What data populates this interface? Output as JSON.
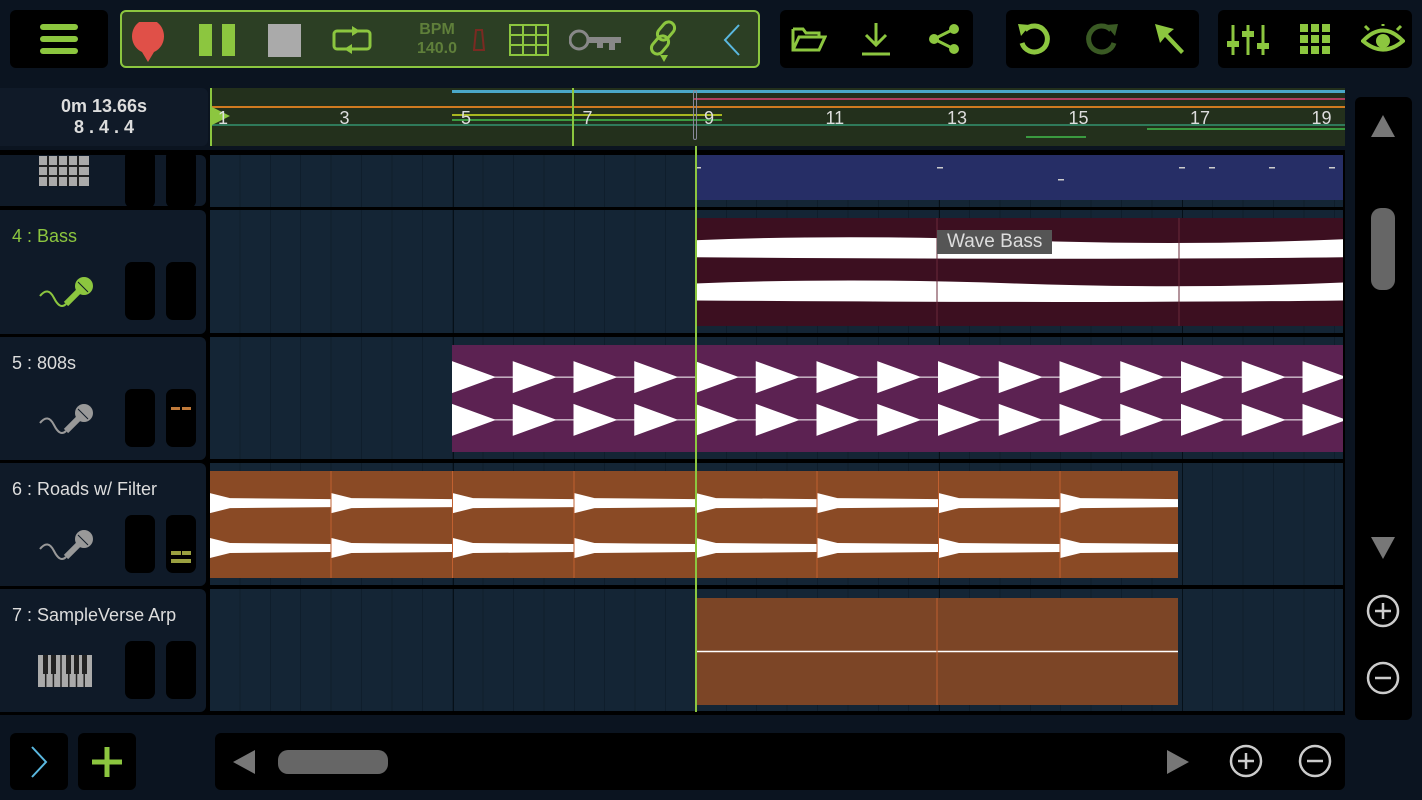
{
  "toolbar": {
    "bpm_label": "BPM",
    "bpm_value": "140.0"
  },
  "position": {
    "time": "0m 13.66s",
    "bars": "8 . 4 . 4"
  },
  "ruler": {
    "ticks": [
      "1",
      "3",
      "5",
      "7",
      "9",
      "11",
      "13",
      "15",
      "17",
      "19"
    ]
  },
  "tracks": [
    {
      "name": "",
      "icon": "drum-pad-icon"
    },
    {
      "name": "4 : Bass",
      "icon": "microphone-icon",
      "selected": true,
      "clip_label": "Wave Bass"
    },
    {
      "name": "5 : 808s",
      "icon": "microphone-icon"
    },
    {
      "name": "6 : Roads w/ Filter",
      "icon": "microphone-icon"
    },
    {
      "name": "7 : SampleVerse Arp",
      "icon": "piano-keyboard-icon"
    }
  ],
  "colors": {
    "accent": "#8cc63f",
    "record": "#e05048",
    "bass_clip": "#3c0f20",
    "clip_808": "#5c2252",
    "roads_clip": "#8a4a25",
    "arp_clip": "#7c4526",
    "drum_clip": "#262e66"
  }
}
